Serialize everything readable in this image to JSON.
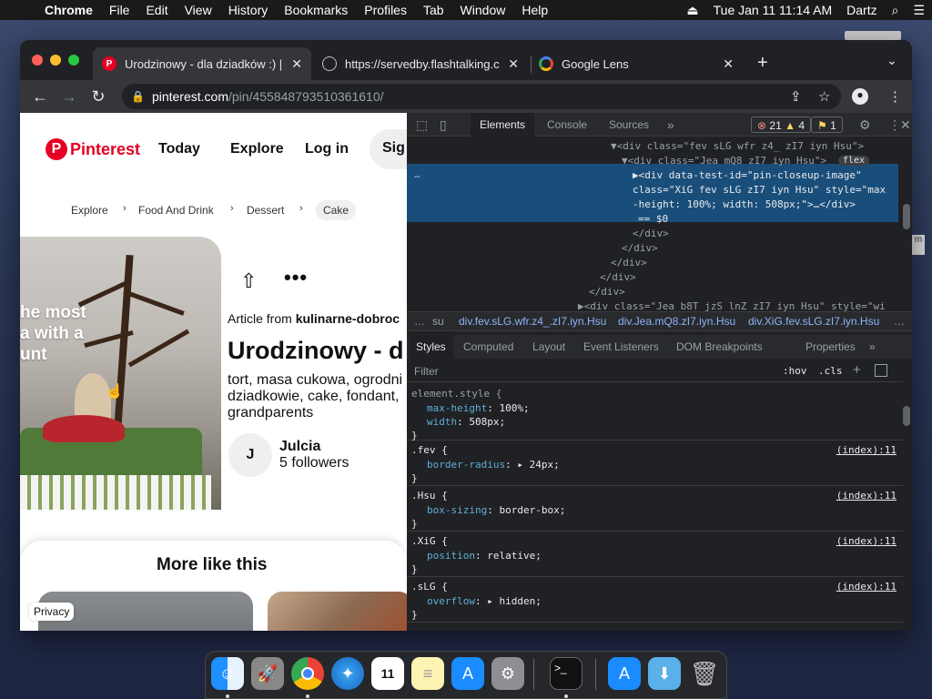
{
  "menubar": {
    "app": "Chrome",
    "menus": [
      "File",
      "Edit",
      "View",
      "History",
      "Bookmarks",
      "Profiles",
      "Tab",
      "Window",
      "Help"
    ],
    "clock": "Tue Jan 11  11:14 AM",
    "user": "Dartz"
  },
  "browser": {
    "tabs": [
      {
        "title": "Urodzinowy - dla dziadków :) | ",
        "favicon": "pinterest-icon"
      },
      {
        "title": "https://servedby.flashtalking.c",
        "favicon": "globe-icon"
      },
      {
        "title": "Google Lens",
        "favicon": "google-lens-icon"
      }
    ],
    "url_host": "pinterest.com",
    "url_path": "/pin/455848793510361610/"
  },
  "pinterest": {
    "logo": "Pinterest",
    "nav": {
      "today": "Today",
      "explore": "Explore",
      "login": "Log in",
      "signup": "Sig"
    },
    "breadcrumbs": [
      "Explore",
      "Food And Drink",
      "Dessert",
      "Cake"
    ],
    "image_text": [
      "he most",
      "a with a",
      "unt"
    ],
    "article_prefix": "Article from ",
    "article_source": "kulinarne-dobroc",
    "title": "Urodzinowy - d",
    "description": "tort, masa cukowa, ogrodni dziadkowie, cake, fondant, grandparents",
    "author_initial": "J",
    "author": "Julcia",
    "followers": "5 followers",
    "more_heading": "More like this",
    "privacy": "Privacy"
  },
  "devtools": {
    "tabs": [
      "Elements",
      "Console",
      "Sources"
    ],
    "errors": "21",
    "warnings": "4",
    "issues": "1",
    "elements": [
      {
        "indent": 232,
        "text": "▼<div class=\"fev sLG wfr z4_ zI7 iyn Hsu\">"
      },
      {
        "indent": 244,
        "text": "▼<div class=\"Jea mQ8 zI7 iyn Hsu\">",
        "badge": "flex"
      },
      {
        "indent": 256,
        "text": "▶<div data-test-id=\"pin-closeup-image\""
      },
      {
        "indent": 256,
        "text": "class=\"XiG fev sLG zI7 iyn Hsu\" style=\"max"
      },
      {
        "indent": 256,
        "text": "-height: 100%; width: 508px;\">…</div>"
      },
      {
        "indent": 262,
        "text": "== $0"
      },
      {
        "indent": 256,
        "text": "</div>"
      },
      {
        "indent": 244,
        "text": "</div>"
      },
      {
        "indent": 232,
        "text": "</div>"
      },
      {
        "indent": 220,
        "text": "</div>"
      },
      {
        "indent": 208,
        "text": "</div>"
      },
      {
        "indent": 196,
        "text": "▶<div class=\"Jea b8T jzS lnZ zI7 iyn Hsu\" style=\"wi"
      }
    ],
    "dom_crumbs": [
      "…",
      "su",
      "div.fev.sLG.wfr.z4_.zI7.iyn.Hsu",
      "div.Jea.mQ8.zI7.iyn.Hsu",
      "div.XiG.fev.sLG.zI7.iyn.Hsu",
      "…"
    ],
    "style_tabs": [
      "Styles",
      "Computed",
      "Layout",
      "Event Listeners",
      "DOM Breakpoints",
      "Properties"
    ],
    "filter_placeholder": "Filter",
    "hov": ":hov",
    "cls": ".cls",
    "rules": [
      {
        "selector": "element.style {",
        "source": "",
        "props": [
          [
            "max-height",
            "100%;"
          ],
          [
            "width",
            "508px;"
          ]
        ]
      },
      {
        "selector": ".fev {",
        "source": "(index):11",
        "props": [
          [
            "border-radius",
            "▸ 24px;"
          ]
        ]
      },
      {
        "selector": ".Hsu {",
        "source": "(index):11",
        "props": [
          [
            "box-sizing",
            "border-box;"
          ]
        ]
      },
      {
        "selector": ".XiG {",
        "source": "(index):11",
        "props": [
          [
            "position",
            "relative;"
          ]
        ]
      },
      {
        "selector": ".sLG {",
        "source": "(index):11",
        "props": [
          [
            "overflow",
            "▸ hidden;"
          ]
        ]
      }
    ],
    "close_brace": "}"
  },
  "colors": {
    "pinterest_red": "#e60023",
    "devtools_bg": "#202124",
    "selection": "#1a4e7a"
  }
}
